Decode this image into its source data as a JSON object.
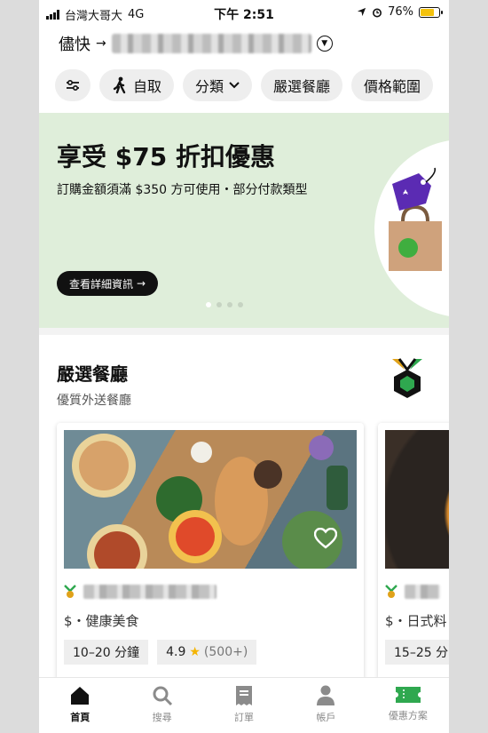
{
  "status_bar": {
    "carrier": "台灣大哥大",
    "network": "4G",
    "time": "下午 2:51",
    "battery": "76%",
    "battery_level": 0.76
  },
  "address": {
    "prefix": "儘快",
    "arrow": "→"
  },
  "filters": [
    {
      "label": "",
      "icon": "sliders-icon"
    },
    {
      "label": "自取",
      "icon": "walk-icon"
    },
    {
      "label": "分類",
      "icon": "chevron-down-icon"
    },
    {
      "label": "嚴選餐廳"
    },
    {
      "label": "價格範圍"
    }
  ],
  "promo": {
    "title": "享受 $75 折扣優惠",
    "subtitle": "訂購金額須滿 $350 方可使用・部分付款類型",
    "button": "查看詳細資訊",
    "button_arrow": "→",
    "page_count": 4,
    "active_page": 1
  },
  "section": {
    "title": "嚴選餐廳",
    "subtitle": "優質外送餐廳"
  },
  "restaurants": [
    {
      "category": "$・健康美食",
      "eta": "10–20 分鐘",
      "rating": "4.9",
      "reviews": "(500+)",
      "favorite": true
    },
    {
      "category": "$・日式料",
      "eta": "15–25 分"
    }
  ],
  "tabs": [
    {
      "label": "首頁",
      "icon": "home-icon",
      "active": true
    },
    {
      "label": "搜尋",
      "icon": "search-icon",
      "active": false
    },
    {
      "label": "訂單",
      "icon": "receipt-icon",
      "active": false
    },
    {
      "label": "帳戶",
      "icon": "person-icon",
      "active": false
    },
    {
      "label": "優惠方案",
      "icon": "ticket-icon",
      "active": false
    }
  ],
  "colors": {
    "accent_green": "#2fa84f",
    "banner_bg": "#dfeeda",
    "star": "#f4b400"
  }
}
